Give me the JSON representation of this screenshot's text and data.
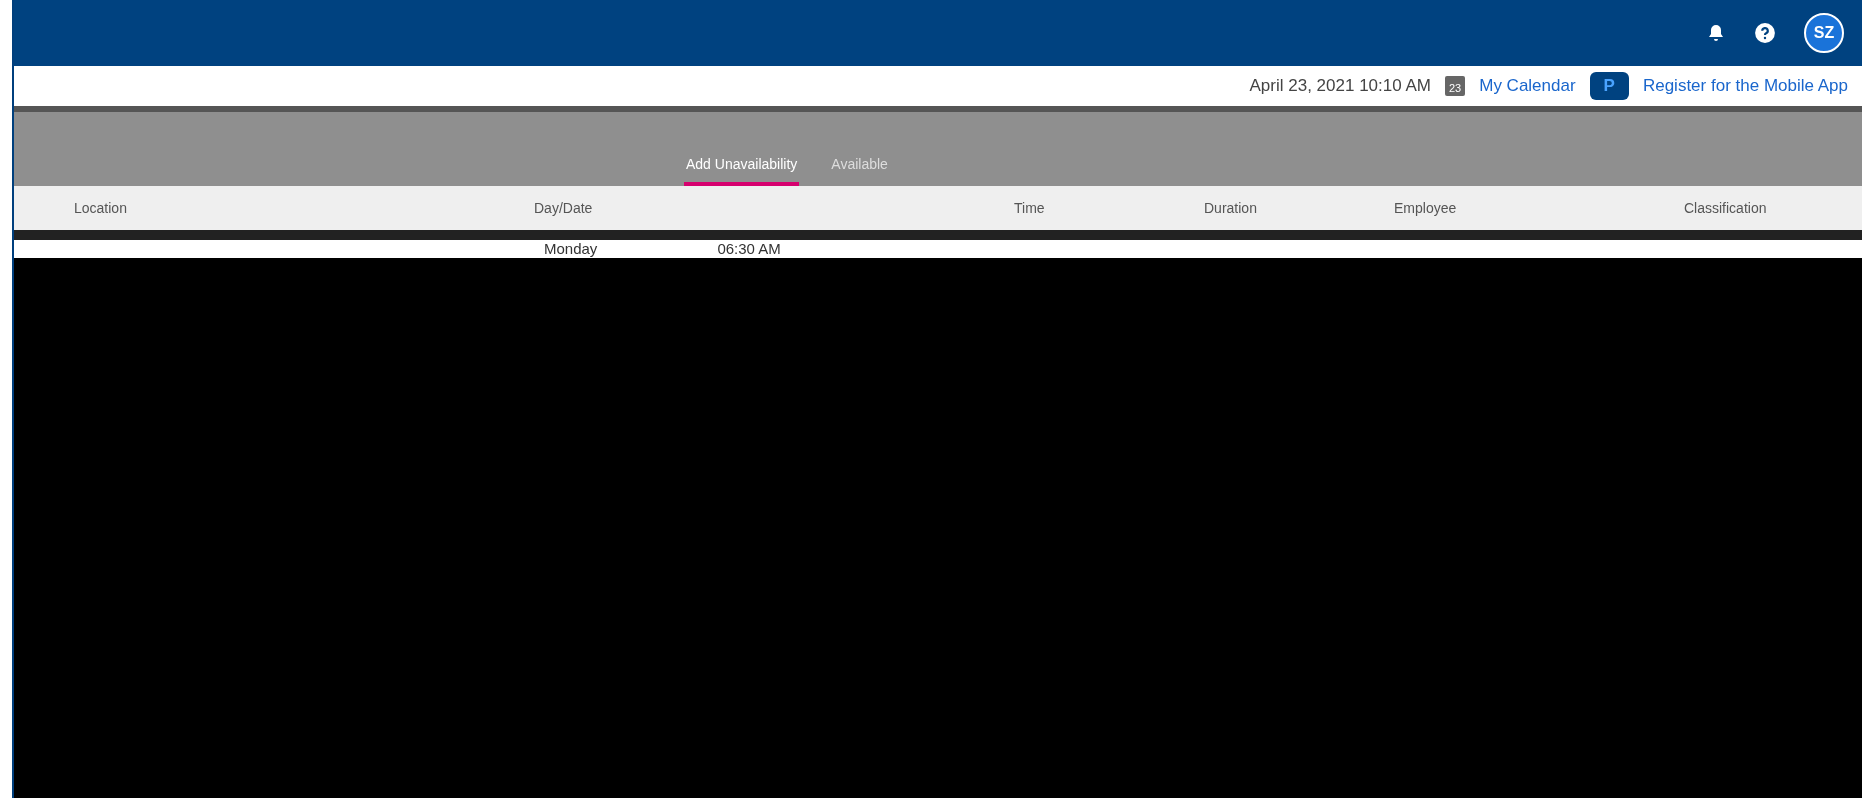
{
  "header": {
    "avatar": "SZ"
  },
  "info_bar": {
    "datetime": "April 23, 2021 10:10 AM",
    "calendar_day": "23",
    "calendar_link": "My Calendar",
    "app_icon": "P",
    "register_link": "Register for the Mobile App"
  },
  "tabs": [
    {
      "label": "Add Unavailability",
      "selected": true
    },
    {
      "label": "Available",
      "selected": false
    }
  ],
  "table": {
    "columns": [
      "Location",
      "Day/Date",
      "Time",
      "Duration",
      "Employee",
      "Classification"
    ],
    "rows": [
      {
        "day": "Monday",
        "time": "06:30 AM"
      }
    ]
  }
}
